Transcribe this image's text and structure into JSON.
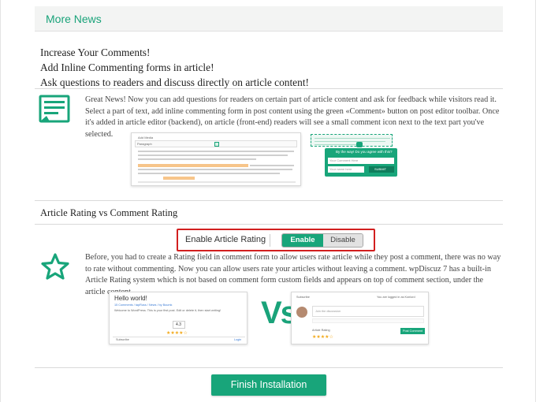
{
  "header": {
    "title": "More News"
  },
  "intro": {
    "line1": "Increase Your Comments!",
    "line2": "Add Inline Commenting forms in article!",
    "line3": "Ask questions to readers and discuss directly on article content!"
  },
  "section1": {
    "text": "Great News! Now you can add questions for readers on certain part of article content and ask for feedback while visitors read it. Select a part of text, add inline commenting form in post content using the green «Comment» button on post editor toolbar. Once it's added in article editor (backend), on article (front-end) readers will see a small comment icon next to the text part you've selected.",
    "editor_tab": "Add Media",
    "editor_dropdown": "Paragraph",
    "popup_question": "By the way! Do you agree with this?",
    "popup_comment_placeholder": "Your Comment Here",
    "popup_name_placeholder": "Your name here",
    "popup_submit": "SUBMIT"
  },
  "section2": {
    "title": "Article Rating vs Comment Rating",
    "toggle_label": "Enable Article Rating",
    "enable_label": "Enable",
    "disable_label": "Disable",
    "text": "Before, you had to create a Rating field in comment form to allow users rate article while they post a comment, there was no way to rate without commenting. Now you can allow users rate your articles without leaving a comment. wpDiscuz 7 has a built-in Article Rating system which is not based on comment form custom fields and appears on top of comment section, under the article content.",
    "left_shot": {
      "title": "Hello world!",
      "meta": "15 Comments / tapRuss / News / by Boumk",
      "body": "Welcome to WordPress. This is your first post. Edit or delete it, then start writing!",
      "score": "4.3",
      "subscribe": "Subscribe",
      "login": "Login"
    },
    "vs_text": "Vs",
    "right_shot": {
      "subscribe": "Subscribe",
      "logged": "You are logged in as Konlord",
      "placeholder": "Join the discussion",
      "rating_label": "Article Rating",
      "post_button": "Post Comment"
    }
  },
  "footer": {
    "finish_label": "Finish Installation"
  },
  "colors": {
    "accent": "#18a57a",
    "highlight": "#d21f1f"
  },
  "icons": {
    "news": "news-list-icon",
    "rating": "star-outline-icon"
  }
}
